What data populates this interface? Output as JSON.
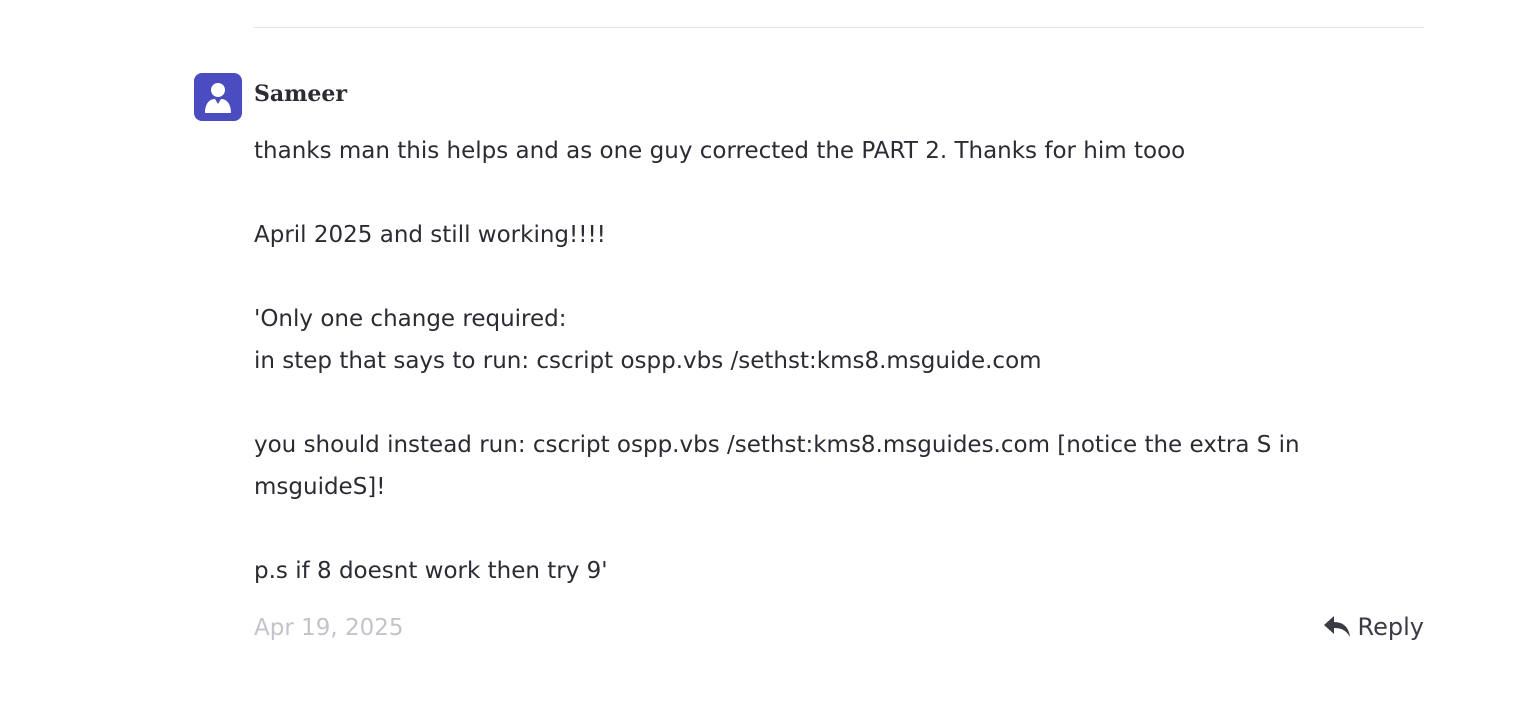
{
  "comment": {
    "author": "Sameer",
    "lines": [
      "thanks man this helps and as one guy corrected the PART 2. Thanks for him tooo",
      "April 2025 and still working!!!!",
      "'Only one change required:",
      "in step that says to run: cscript ospp.vbs /sethst:kms8.msguide.com",
      "you should instead run: cscript ospp.vbs /sethst:kms8.msguides.com [notice the extra S in msguideS]!",
      "p.s if 8 doesnt work then try 9'"
    ],
    "date": "Apr 19, 2025",
    "reply_label": "Reply",
    "avatar_icon": "user-icon",
    "reply_icon": "reply-arrow-icon"
  },
  "colors": {
    "avatar_bg": "#4a4cc0",
    "text": "#2b2b33",
    "date": "#c3c3cc",
    "divider": "#e3e3e8"
  }
}
